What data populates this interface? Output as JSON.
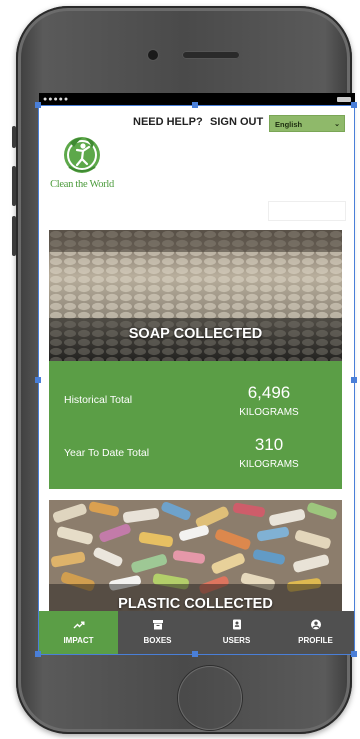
{
  "header": {
    "need_help": "NEED HELP?",
    "sign_out": "SIGN OUT",
    "language": "English"
  },
  "logo": {
    "text": "Clean the World"
  },
  "soap_card": {
    "title": "SOAP COLLECTED",
    "historical_label": "Historical Total",
    "historical_value": "6,496",
    "historical_unit": "KILOGRAMS",
    "ytd_label": "Year To Date Total",
    "ytd_value": "310",
    "ytd_unit": "KILOGRAMS"
  },
  "plastic_card": {
    "title": "PLASTIC COLLECTED"
  },
  "tabs": [
    {
      "label": "IMPACT",
      "icon": "trending-up-icon",
      "active": true
    },
    {
      "label": "BOXES",
      "icon": "archive-box-icon",
      "active": false
    },
    {
      "label": "USERS",
      "icon": "contact-card-icon",
      "active": false
    },
    {
      "label": "PROFILE",
      "icon": "user-circle-icon",
      "active": false
    }
  ],
  "colors": {
    "brand_green": "#5b9e46",
    "tabbar_bg": "#505050",
    "language_select_bg": "#8fb96a"
  }
}
